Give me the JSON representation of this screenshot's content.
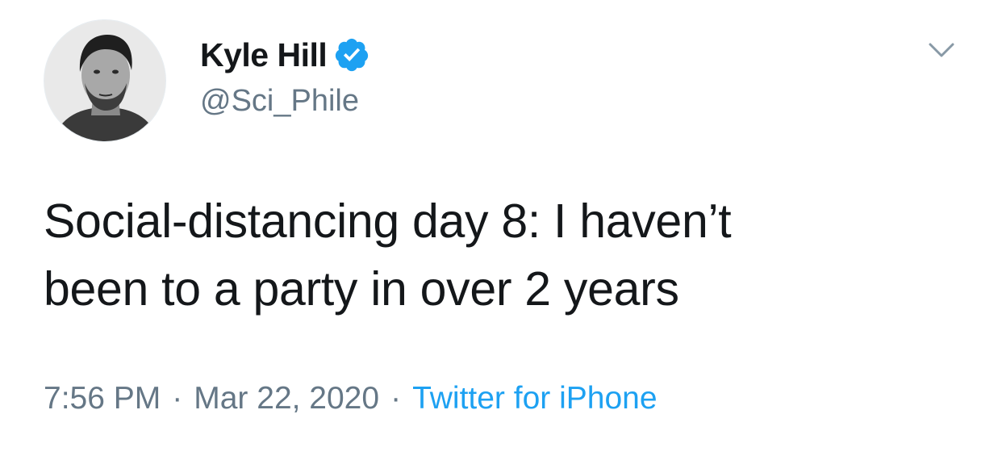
{
  "author": {
    "display_name": "Kyle Hill",
    "handle": "@Sci_Phile",
    "verified": true,
    "verified_color": "#1da1f2"
  },
  "tweet": {
    "text_lines": [
      "Social-distancing day 8: I haven’t",
      "been to a party in over 2 years"
    ],
    "time": "7:56 PM",
    "date": "Mar 22, 2020",
    "separator": "·",
    "source": "Twitter for iPhone"
  },
  "icons": {
    "menu": "chevron-down-icon",
    "verified": "verified-badge-icon"
  },
  "colors": {
    "text": "#14171a",
    "secondary": "#657786",
    "link": "#1da1f2",
    "background": "#ffffff"
  }
}
